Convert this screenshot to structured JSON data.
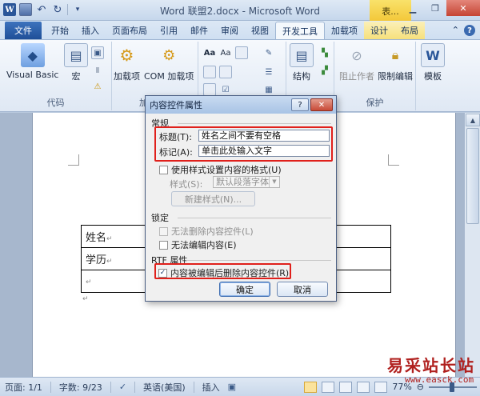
{
  "titlebar": {
    "title": "Word 联盟2.docx - Microsoft Word",
    "context_tab": "表...",
    "qat_icons": [
      "word-icon",
      "save-icon",
      "undo-icon",
      "redo-icon"
    ]
  },
  "tabs": [
    {
      "label": "文件"
    },
    {
      "label": "开始"
    },
    {
      "label": "插入"
    },
    {
      "label": "页面布局"
    },
    {
      "label": "引用"
    },
    {
      "label": "邮件"
    },
    {
      "label": "审阅"
    },
    {
      "label": "视图"
    },
    {
      "label": "开发工具"
    },
    {
      "label": "加载项"
    },
    {
      "label": "设计"
    },
    {
      "label": "布局"
    }
  ],
  "ribbon": {
    "code_group": {
      "label": "代码",
      "visual_basic": "Visual Basic",
      "macro": "宏"
    },
    "addins_group": {
      "label": "加",
      "addins": "加载项",
      "com_addins": "COM 加载项"
    },
    "structure": "结构",
    "protect_group": {
      "label": "保护",
      "block_authors": "阻止作者",
      "restrict_editing": "限制编辑"
    },
    "template": "模板"
  },
  "document": {
    "rows": [
      {
        "label": "姓名",
        "mark": "↵"
      },
      {
        "label": "学历",
        "mark": "↵"
      },
      {
        "label": "",
        "mark": "↵"
      }
    ],
    "end_mark": "↵"
  },
  "dialog": {
    "title": "内容控件属性",
    "help": "?",
    "close": "✕",
    "general_head": "常规",
    "title_label": "标题(T):",
    "title_value": "姓名之间不要有空格",
    "tag_label": "标记(A):",
    "tag_value": "单击此处输入文字",
    "use_style_label": "使用样式设置内容的格式(U)",
    "style_label": "样式(S):",
    "style_value": "默认段落字体",
    "new_style_button": "新建样式(N)...",
    "lock_head": "锁定",
    "cannot_delete": "无法删除内容控件(L)",
    "cannot_edit": "无法编辑内容(E)",
    "rtf_head": "RTF 属性",
    "remove_after_edit": "内容被编辑后删除内容控件(R)",
    "ok": "确定",
    "cancel": "取消"
  },
  "statusbar": {
    "page": "页面: 1/1",
    "words": "字数: 9/23",
    "language": "英语(美国)",
    "insert": "插入",
    "zoom": "77%"
  },
  "watermark": {
    "title": "易采站长站",
    "url": "www.easck.com"
  }
}
